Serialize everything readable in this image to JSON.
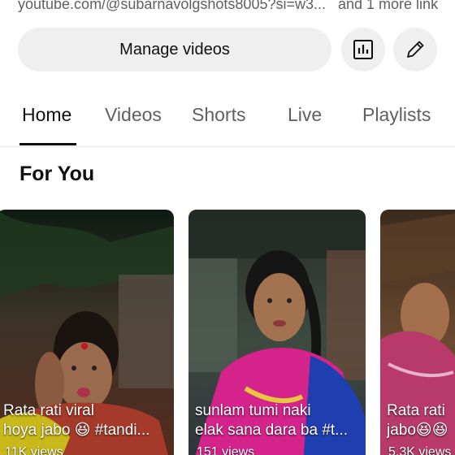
{
  "channel_link": {
    "url": "youtube.com/@subarnavolgshots8005?si=w3...",
    "more": "and 1 more link"
  },
  "actions": {
    "manage_label": "Manage videos",
    "analytics_icon": "bar-chart-icon",
    "edit_icon": "pencil-icon"
  },
  "tabs": [
    {
      "label": "Home",
      "active": true
    },
    {
      "label": "Videos",
      "active": false
    },
    {
      "label": "Shorts",
      "active": false
    },
    {
      "label": "Live",
      "active": false
    },
    {
      "label": "Playlists",
      "active": false
    }
  ],
  "section": {
    "title": "For You"
  },
  "cards": [
    {
      "title_line1": "Rata rati viral",
      "title_line2": "hoya jabo 😆 #tandi...",
      "views": "11K views"
    },
    {
      "title_line1": "sunlam tumi naki",
      "title_line2": "elak sana dara ba #t...",
      "views": "151 views"
    },
    {
      "title_line1": "Rata rati",
      "title_line2": "jabo😆😆",
      "views": "5.3K views"
    }
  ],
  "colors": {
    "text_primary": "#0f0f0f",
    "text_secondary": "#606060",
    "button_bg": "#efefef"
  }
}
